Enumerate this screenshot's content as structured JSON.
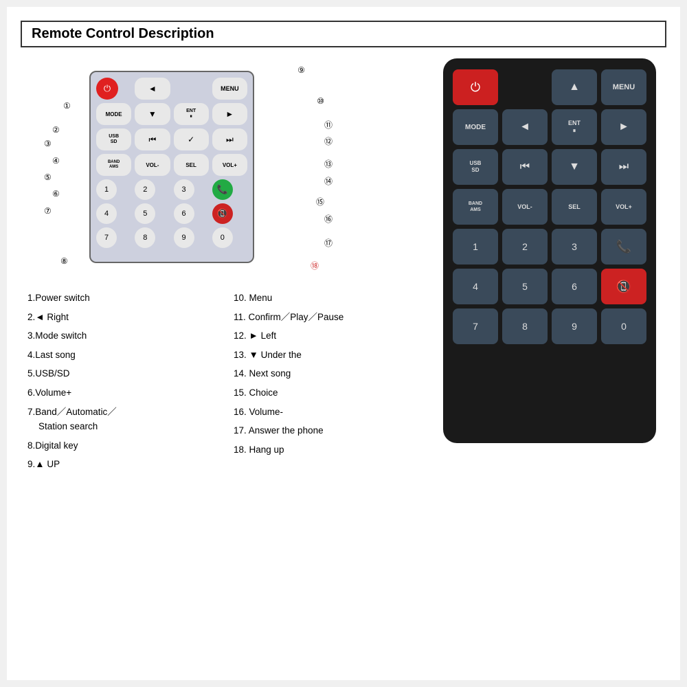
{
  "title": "Remote Control Description",
  "diagram": {
    "buttons": [
      {
        "id": "power",
        "label": "⏻",
        "type": "red"
      },
      {
        "id": "left-arrow",
        "label": "◄",
        "type": "small"
      },
      {
        "id": "menu",
        "label": "MENU",
        "type": "small"
      },
      {
        "id": "mode",
        "label": "MODE",
        "type": "small"
      },
      {
        "id": "ent",
        "label": "ENT\n⏸",
        "type": "small"
      },
      {
        "id": "play",
        "label": "►",
        "type": "small"
      },
      {
        "id": "usb",
        "label": "USB\nSD",
        "type": "small"
      },
      {
        "id": "prev",
        "label": "⏮",
        "type": "small"
      },
      {
        "id": "down-arrow",
        "label": "▼",
        "type": "small"
      },
      {
        "id": "next",
        "label": "⏭",
        "type": "small"
      },
      {
        "id": "band",
        "label": "BAND\nAMS",
        "type": "small"
      },
      {
        "id": "vol-",
        "label": "VOL-",
        "type": "small"
      },
      {
        "id": "sel",
        "label": "SEL",
        "type": "small"
      },
      {
        "id": "vol+",
        "label": "VOL+",
        "type": "small"
      },
      {
        "id": "n1",
        "label": "1",
        "type": "num"
      },
      {
        "id": "n2",
        "label": "2",
        "type": "num"
      },
      {
        "id": "n3",
        "label": "3",
        "type": "num"
      },
      {
        "id": "answer",
        "label": "📞",
        "type": "green-phone"
      },
      {
        "id": "n4",
        "label": "4",
        "type": "num"
      },
      {
        "id": "n5",
        "label": "5",
        "type": "num"
      },
      {
        "id": "n6",
        "label": "6",
        "type": "num"
      },
      {
        "id": "hangup",
        "label": "📵",
        "type": "red-phone"
      },
      {
        "id": "n7",
        "label": "7",
        "type": "num"
      },
      {
        "id": "n8",
        "label": "8",
        "type": "num"
      },
      {
        "id": "n9",
        "label": "9",
        "type": "num"
      },
      {
        "id": "n0",
        "label": "0",
        "type": "num"
      }
    ]
  },
  "descriptions": {
    "left": [
      {
        "num": "1",
        "text": "Power switch"
      },
      {
        "num": "2",
        "text": "◄ Right"
      },
      {
        "num": "3",
        "text": "Mode switch"
      },
      {
        "num": "4",
        "text": "Last song"
      },
      {
        "num": "5",
        "text": "USB/SD"
      },
      {
        "num": "6",
        "text": "Volume+"
      },
      {
        "num": "7",
        "text": "Band／Automatic／\n    Station search"
      },
      {
        "num": "8",
        "text": "Digital key"
      },
      {
        "num": "9",
        "text": "▲ UP"
      }
    ],
    "right": [
      {
        "num": "10",
        "text": "Menu"
      },
      {
        "num": "11",
        "text": "Confirm／Play／Pause"
      },
      {
        "num": "12",
        "text": "► Left"
      },
      {
        "num": "13",
        "text": "▼ Under the"
      },
      {
        "num": "14",
        "text": "Next song"
      },
      {
        "num": "15",
        "text": "Choice"
      },
      {
        "num": "16",
        "text": "Volume-"
      },
      {
        "num": "17",
        "text": "Answer the phone"
      },
      {
        "num": "18",
        "text": "Hang up"
      }
    ]
  },
  "callouts": [
    {
      "n": "①",
      "pos": "left:60px;top:65px"
    },
    {
      "n": "②",
      "pos": "left:48px;top:100px"
    },
    {
      "n": "③",
      "pos": "left:36px;top:120px"
    },
    {
      "n": "④",
      "pos": "left:48px;top:148px"
    },
    {
      "n": "⑤",
      "pos": "left:36px;top:170px"
    },
    {
      "n": "⑥",
      "pos": "left:48px;top:192px"
    },
    {
      "n": "⑦",
      "pos": "left:36px;top:218px"
    },
    {
      "n": "⑧",
      "pos": "left:60px;top:290px"
    },
    {
      "n": "⑨",
      "pos": "right:60px;top:8px"
    },
    {
      "n": "⑩",
      "pos": "right:30px;top:55px"
    },
    {
      "n": "⑪",
      "pos": "right:18px;top:90px"
    },
    {
      "n": "⑫",
      "pos": "right:6px;top:115px"
    },
    {
      "n": "⑬",
      "pos": "right:6px;top:148px"
    },
    {
      "n": "⑭",
      "pos": "right:6px;top:175px"
    },
    {
      "n": "⑮",
      "pos": "right:20px;top:205px"
    },
    {
      "n": "⑯",
      "pos": "right:6px;top:228px"
    },
    {
      "n": "⑰",
      "pos": "right:6px;top:260px"
    },
    {
      "n": "⑱",
      "pos": "right:30px;top:295px"
    }
  ]
}
